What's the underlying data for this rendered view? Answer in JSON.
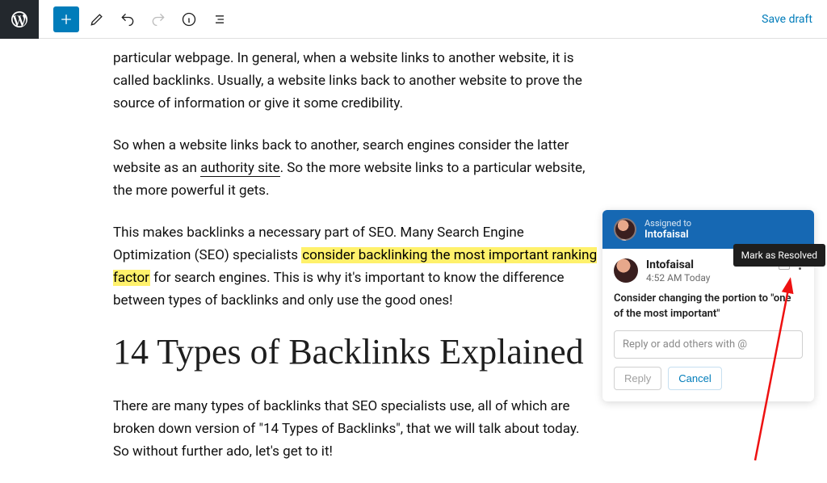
{
  "toolbar": {
    "save_draft": "Save draft"
  },
  "content": {
    "p1_a": "particular webpage. In general, when a website links to another website, it is called backlinks. Usually, a website links back to another website to prove the source of information or give it some credibility.",
    "p2_a": "So when a website links back to another, search engines consider the latter website as an ",
    "p2_link": "authority site",
    "p2_b": ". So the more website links to a particular website, the more powerful it gets.",
    "p3_a": "This makes backlinks a necessary part of SEO. Many Search Engine Optimization (SEO) specialists ",
    "p3_hl": "consider backlinking the most important ranking factor",
    "p3_b": " for search engines. This is why it's important to know the difference between types of backlinks and only use the good ones!",
    "h2": "14 Types of Backlinks Explained",
    "p4": "There are many types of backlinks that SEO specialists use, all of which are broken down version of \"14 Types of Backlinks\", that we will talk about today. So without further ado, let's get to it!"
  },
  "comment": {
    "assigned_label": "Assigned to",
    "assignee": "Intofaisal",
    "author": "Intofaisal",
    "time": "4:52 AM Today",
    "text": "Consider changing the portion to \"one of the most important\"",
    "reply_placeholder": "Reply or add others with @",
    "reply_btn": "Reply",
    "cancel_btn": "Cancel",
    "tooltip": "Mark as Resolved"
  }
}
